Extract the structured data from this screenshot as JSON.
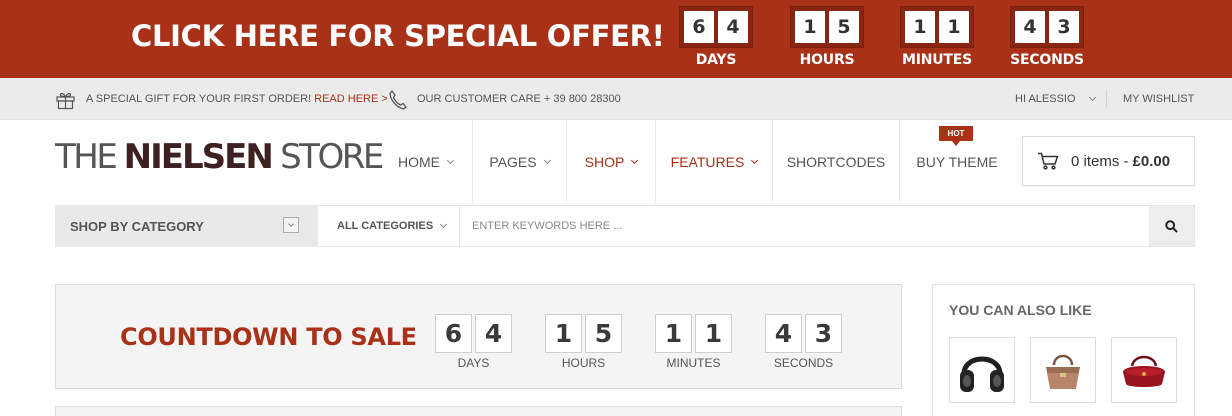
{
  "offer_bar": {
    "text": "CLICK HERE FOR SPECIAL OFFER!",
    "countdown": [
      {
        "digits": [
          "6",
          "4"
        ],
        "unit": "DAYS"
      },
      {
        "digits": [
          "1",
          "5"
        ],
        "unit": "HOURS"
      },
      {
        "digits": [
          "1",
          "1"
        ],
        "unit": "MINUTES"
      },
      {
        "digits": [
          "4",
          "3"
        ],
        "unit": "SECONDS"
      }
    ]
  },
  "util_bar": {
    "gift_text": "A SPECIAL GIFT FOR YOUR FIRST ORDER!",
    "gift_link": "READ HERE >",
    "care_text": "OUR CUSTOMER CARE + 39 800 28300",
    "user_menu": "HI ALESSIO",
    "wishlist": "MY WISHLIST"
  },
  "logo": {
    "part1": "THE ",
    "part2": "NIELSEN",
    "part3": " STORE"
  },
  "nav": {
    "items": [
      {
        "label": "HOME",
        "dropdown": true
      },
      {
        "label": "PAGES",
        "dropdown": true
      },
      {
        "label": "SHOP",
        "dropdown": true
      },
      {
        "label": "FEATURES",
        "dropdown": true
      },
      {
        "label": "SHORTCODES",
        "dropdown": false
      },
      {
        "label": "BUY THEME",
        "dropdown": false
      }
    ],
    "badge": "HOT"
  },
  "cart": {
    "items": "0 items",
    "separator": "-",
    "total": "£0.00"
  },
  "search": {
    "category_label": "SHOP BY CATEGORY",
    "all_categories": "ALL CATEGORIES",
    "placeholder": "ENTER KEYWORDS HERE ..."
  },
  "sale": {
    "title": "COUNTDOWN TO SALE",
    "countdown": [
      {
        "digits": [
          "6",
          "4"
        ],
        "unit": "DAYS"
      },
      {
        "digits": [
          "1",
          "5"
        ],
        "unit": "HOURS"
      },
      {
        "digits": [
          "1",
          "1"
        ],
        "unit": "MINUTES"
      },
      {
        "digits": [
          "4",
          "3"
        ],
        "unit": "SECONDS"
      }
    ]
  },
  "related": {
    "title": "YOU CAN ALSO LIKE",
    "products": [
      "headphones",
      "handbag",
      "red-purse"
    ]
  },
  "colors": {
    "accent": "#a83118",
    "offer_bg": "#a83118",
    "util_bg": "#ebebeb"
  }
}
